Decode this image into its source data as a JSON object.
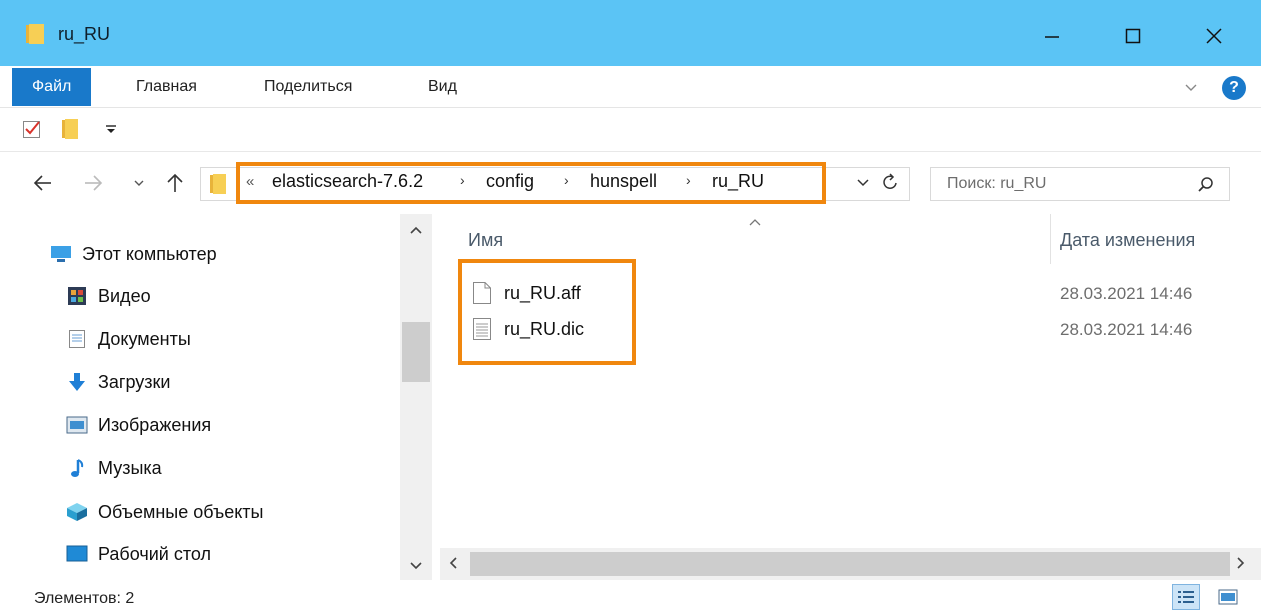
{
  "window": {
    "title": "ru_RU",
    "icon": "folder-icon"
  },
  "ribbon": {
    "tabs": [
      {
        "label": "Файл"
      },
      {
        "label": "Главная"
      },
      {
        "label": "Поделиться"
      },
      {
        "label": "Вид"
      }
    ],
    "help_label": "?"
  },
  "address": {
    "overflow": "«",
    "crumbs": [
      "elasticsearch-7.6.2",
      "config",
      "hunspell",
      "ru_RU"
    ],
    "separator": "›",
    "highlight_color": "#f0870e"
  },
  "search": {
    "placeholder": "Поиск: ru_RU"
  },
  "navpane": {
    "items": [
      {
        "label": "Этот компьютер",
        "icon": "computer-icon"
      },
      {
        "label": "Видео",
        "icon": "video-icon"
      },
      {
        "label": "Документы",
        "icon": "documents-icon"
      },
      {
        "label": "Загрузки",
        "icon": "downloads-icon"
      },
      {
        "label": "Изображения",
        "icon": "pictures-icon"
      },
      {
        "label": "Музыка",
        "icon": "music-icon"
      },
      {
        "label": "Объемные объекты",
        "icon": "3d-objects-icon"
      },
      {
        "label": "Рабочий стол",
        "icon": "desktop-icon"
      }
    ]
  },
  "content": {
    "columns": {
      "name": "Имя",
      "date": "Дата изменения"
    },
    "files": [
      {
        "name": "ru_RU.aff",
        "date": "28.03.2021 14:46",
        "icon": "file-icon"
      },
      {
        "name": "ru_RU.dic",
        "date": "28.03.2021 14:46",
        "icon": "text-file-icon"
      }
    ]
  },
  "status": {
    "items_text": "Элементов: 2"
  },
  "colors": {
    "titlebar": "#5bc4f5",
    "file_tab": "#1979ca",
    "highlight": "#f0870e"
  }
}
